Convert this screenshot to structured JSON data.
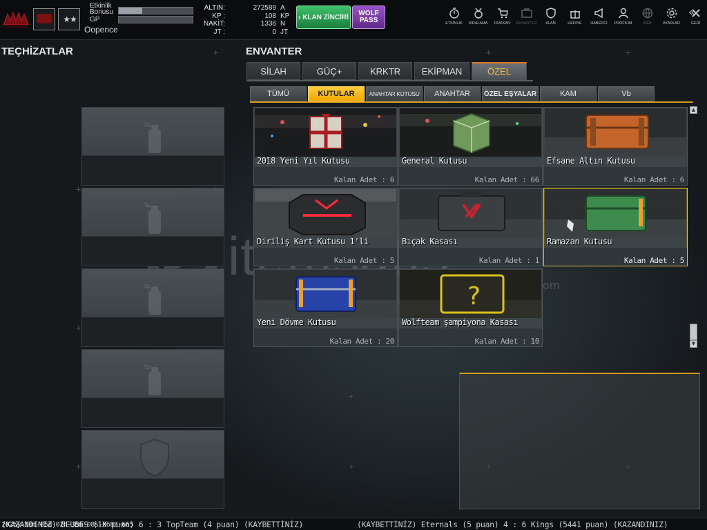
{
  "player": {
    "etkinlik_label": "Etkinlik",
    "bonusu_label": "Bonusu",
    "etkinlik_progress": 0.32,
    "gp_label": "GP",
    "gp_progress": 0.0,
    "username": "Oopence",
    "rank_badge": "★★"
  },
  "currency": [
    {
      "label": "ALTIN:",
      "value": "272589",
      "unit": "A"
    },
    {
      "label": "KP  :",
      "value": "108",
      "unit": "KP"
    },
    {
      "label": "NAKİT:",
      "value": "1336",
      "unit": "N"
    },
    {
      "label": "JT  :",
      "value": "0",
      "unit": "JT"
    }
  ],
  "buttons": {
    "klan_zinciri": "› KLAN ZİNCİRİ",
    "wolf_pass_1": "WOLF",
    "wolf_pass_2": "PASS"
  },
  "topnav": [
    {
      "label": "ETKİNLİK",
      "icon": "stopwatch-icon",
      "enabled": true
    },
    {
      "label": "SIRALAMA",
      "icon": "medal-icon",
      "enabled": true
    },
    {
      "label": "DÜKKAN",
      "icon": "cart-icon",
      "enabled": true
    },
    {
      "label": "ENVANTER",
      "icon": "inventory-icon",
      "enabled": false
    },
    {
      "label": "KLAN",
      "icon": "shield-icon",
      "enabled": true
    },
    {
      "label": "HEDİYE",
      "icon": "gift-icon",
      "enabled": true
    },
    {
      "label": "HABERCİ",
      "icon": "megaphone-icon",
      "enabled": true
    },
    {
      "label": "PROFİLİM",
      "icon": "profile-icon",
      "enabled": true
    },
    {
      "label": "WEB",
      "icon": "globe-icon",
      "enabled": false
    },
    {
      "label": "AYARLAR",
      "icon": "gear-icon",
      "enabled": true
    },
    {
      "label": "GERİ",
      "icon": "close-icon",
      "enabled": true
    }
  ],
  "equipment": {
    "title": "TEÇHİZATLAR"
  },
  "inventory": {
    "title": "ENVANTER",
    "tabs": [
      {
        "label": "SİLAH",
        "active": false
      },
      {
        "label": "GÜÇ+",
        "active": false
      },
      {
        "label": "KRKTR",
        "active": false
      },
      {
        "label": "EKİPMAN",
        "active": false
      },
      {
        "label": "ÖZEL",
        "active": true
      }
    ],
    "subtabs": [
      {
        "label": "TÜMÜ",
        "active": false
      },
      {
        "label": "KUTULAR",
        "active": true
      },
      {
        "label": "ANAHTAR KUTUSU",
        "active": false
      },
      {
        "label": "ANAHTAR",
        "active": false
      },
      {
        "label": "ÖZEL EŞYALAR",
        "active": false
      },
      {
        "label": "KAM",
        "active": false
      },
      {
        "label": "Vb",
        "active": false
      }
    ],
    "items": [
      {
        "name": "2018 Yeni Yıl Kutusu",
        "count": "Kalan Adet : 6",
        "color": "#c9b69a",
        "selected": false
      },
      {
        "name": "General Kutusu",
        "count": "Kalan Adet : 66",
        "color": "#6f9a5a",
        "selected": false
      },
      {
        "name": "Efsane Altın Kutusu",
        "count": "Kalan Adet : 6",
        "color": "#c4662c",
        "selected": false
      },
      {
        "name": "Diriliş Kart Kutusu 1'li",
        "count": "Kalan Adet : 5",
        "color": "#b8202a",
        "selected": false
      },
      {
        "name": "Bıçak Kasası",
        "count": "Kalan Adet : 1",
        "color": "#3b3f42",
        "selected": false
      },
      {
        "name": "Ramazan Kutusu",
        "count": "Kalan Adet : 5",
        "color": "#3c8a4c",
        "selected": true
      },
      {
        "name": "Yeni Dövme Kutusu",
        "count": "Kalan Adet : 20",
        "color": "#2743a8",
        "selected": false
      },
      {
        "name": "Wolfteam şampiyona Kasası",
        "count": "Kalan Adet : 10",
        "color": "#d9c21a",
        "selected": false
      }
    ]
  },
  "watermark": {
    "main": "itemsatış",
    "sub": "HESAP SATIŞ",
    "com": ".com"
  },
  "ticker": {
    "left": "(KAZANDINIZ) BEUBES (1X puan) 6 : 3 TopTeam (4 puan) (KAYBETTİNİZ)",
    "right": "(KAYBETTİNİZ) Eternals (5 puan) 4 : 6 Kings (5441 puan) (KAZANDINIZ)",
    "timestamp": "2025y-10m-05d-02h-35m-08s-0683-665"
  }
}
